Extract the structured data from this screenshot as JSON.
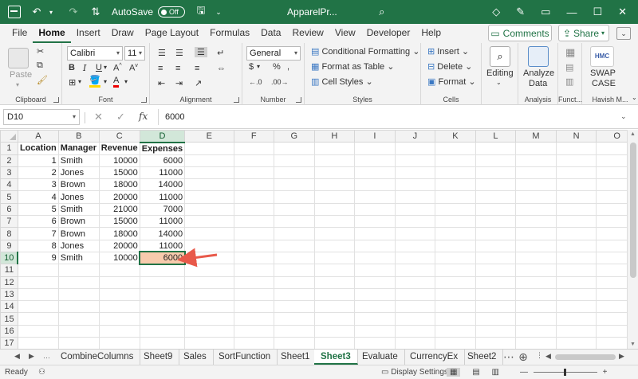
{
  "titlebar": {
    "autosave_label": "AutoSave",
    "autosave_state": "Off",
    "document_title": "ApparelPr..."
  },
  "ribbon_tabs": [
    "File",
    "Home",
    "Insert",
    "Draw",
    "Page Layout",
    "Formulas",
    "Data",
    "Review",
    "View",
    "Developer",
    "Help"
  ],
  "active_tab": "Home",
  "comments_label": "Comments",
  "share_label": "Share",
  "ribbon": {
    "clipboard": {
      "paste": "Paste",
      "label": "Clipboard"
    },
    "font": {
      "name": "Calibri",
      "size": "11",
      "label": "Font"
    },
    "alignment": {
      "label": "Alignment"
    },
    "number": {
      "format": "General",
      "label": "Number"
    },
    "styles": {
      "conditional": "Conditional Formatting",
      "format_table": "Format as Table",
      "cell_styles": "Cell Styles",
      "label": "Styles"
    },
    "cells": {
      "insert": "Insert",
      "delete": "Delete",
      "format": "Format",
      "label": "Cells"
    },
    "editing": {
      "label": "Editing"
    },
    "analysis": {
      "analyze": "Analyze",
      "data": "Data",
      "label": "Analysis"
    },
    "functions": {
      "label": "Funct..."
    },
    "havish": {
      "logo": "HMC",
      "swap": "SWAP",
      "case": "CASE",
      "label": "Havish M..."
    }
  },
  "formula_bar": {
    "name_box": "D10",
    "fx": "fx",
    "value": "6000"
  },
  "columns": [
    "A",
    "B",
    "C",
    "D",
    "E",
    "F",
    "G",
    "H",
    "I",
    "J",
    "K",
    "L",
    "M",
    "N",
    "O"
  ],
  "rows": [
    [
      "Location",
      "Manager",
      "Revenue",
      "Expenses"
    ],
    [
      "1",
      "Smith",
      "10000",
      "6000"
    ],
    [
      "2",
      "Jones",
      "15000",
      "11000"
    ],
    [
      "3",
      "Brown",
      "18000",
      "14000"
    ],
    [
      "4",
      "Jones",
      "20000",
      "11000"
    ],
    [
      "5",
      "Smith",
      "21000",
      "7000"
    ],
    [
      "6",
      "Brown",
      "15000",
      "11000"
    ],
    [
      "7",
      "Brown",
      "18000",
      "14000"
    ],
    [
      "8",
      "Jones",
      "20000",
      "11000"
    ],
    [
      "9",
      "Smith",
      "10000",
      "6000"
    ]
  ],
  "row_numbers": [
    "1",
    "2",
    "3",
    "4",
    "5",
    "6",
    "7",
    "8",
    "9",
    "10",
    "11",
    "12",
    "13",
    "14",
    "15",
    "16",
    "17"
  ],
  "active_cell": "D10",
  "sheet_tabs": [
    "CombineColumns",
    "Sheet9",
    "Sales",
    "SortFunction",
    "Sheet1",
    "Sheet3",
    "Evaluate",
    "CurrencyEx",
    "Sheet2"
  ],
  "active_sheet": "Sheet3",
  "status": {
    "ready": "Ready",
    "display_settings": "Display Settings"
  },
  "colors": {
    "excel_green": "#217346",
    "highlight_cell": "#f8cbad",
    "arrow": "#e8594a"
  }
}
